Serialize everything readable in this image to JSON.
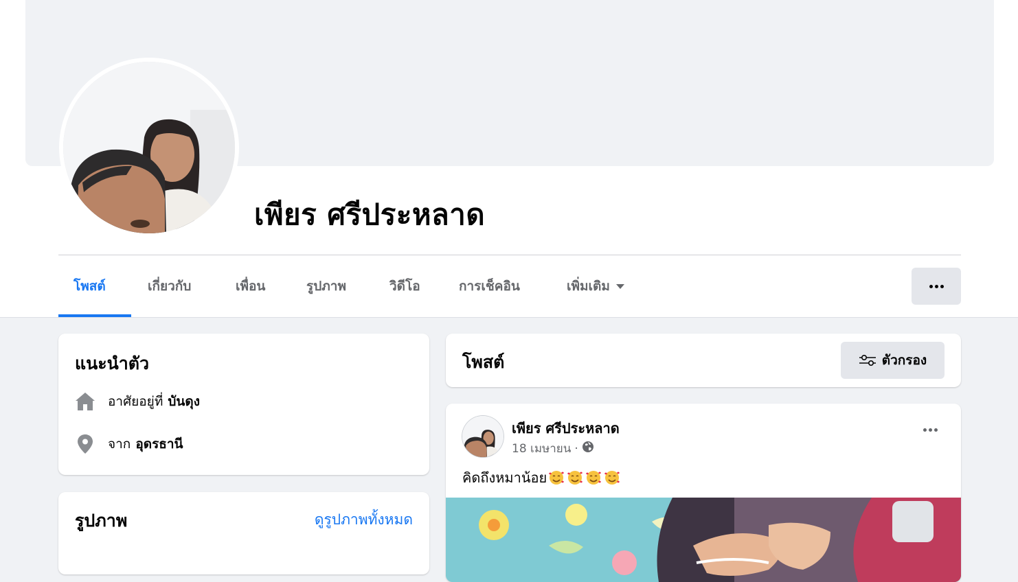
{
  "profile": {
    "name": "เพียร ศรีประหลาด"
  },
  "tabs": [
    {
      "label": "โพสต์",
      "active": true
    },
    {
      "label": "เกี่ยวกับ"
    },
    {
      "label": "เพื่อน"
    },
    {
      "label": "รูปภาพ"
    },
    {
      "label": "วิดีโอ"
    },
    {
      "label": "การเช็คอิน"
    },
    {
      "label": "เพิ่มเติม"
    }
  ],
  "intro": {
    "title": "แนะนำตัว",
    "lives_prefix": "อาศัยอยู่ที่",
    "lives_value": "บันดุง",
    "from_prefix": "จาก",
    "from_value": "อุดรธานี"
  },
  "photos": {
    "title": "รูปภาพ",
    "see_all": "ดูรูปภาพทั้งหมด"
  },
  "posts_header": {
    "title": "โพสต์",
    "filter_label": "ตัวกรอง"
  },
  "post": {
    "author": "เพียร ศรีประหลาด",
    "date": "18 เมษายน",
    "separator": "·",
    "text": "คิดถึงหมาน้อย"
  },
  "icons": {
    "more": "more-horizontal-icon",
    "home": "home-icon",
    "location": "location-pin-icon",
    "filter": "filter-sliders-icon",
    "globe": "globe-icon",
    "emoji": "smiling-face-with-hearts-icon"
  },
  "colors": {
    "accent": "#1877f2",
    "background": "#f0f2f5",
    "secondary_text": "#65676b"
  }
}
